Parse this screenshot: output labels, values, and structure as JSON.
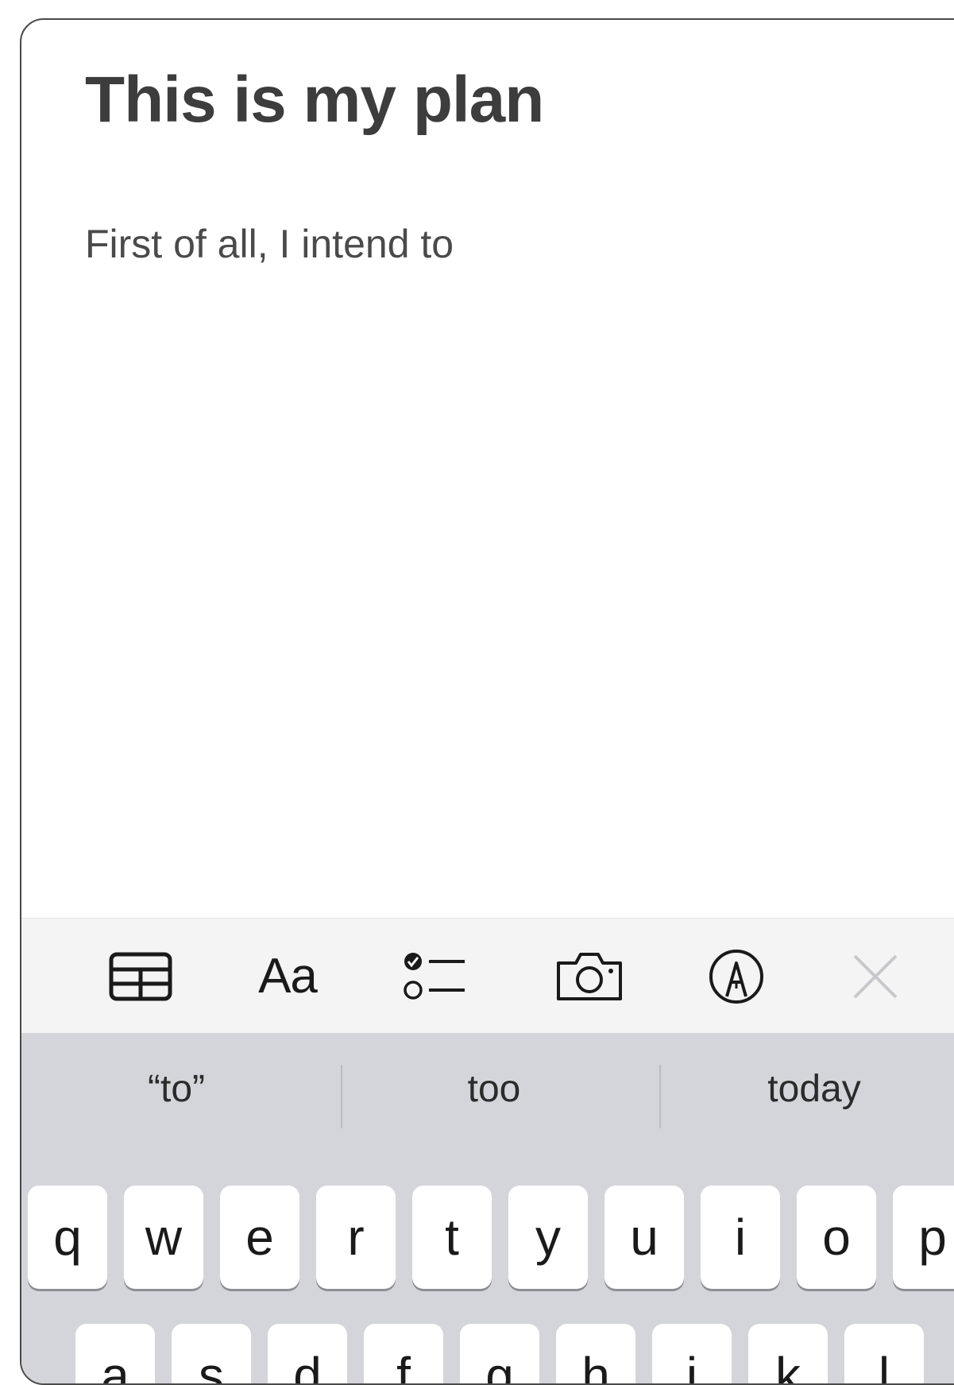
{
  "note": {
    "title": "This is my plan",
    "body": "First of all, I intend to"
  },
  "toolbar": {
    "items": [
      {
        "name": "table-icon"
      },
      {
        "name": "text-format-icon",
        "label": "Aa"
      },
      {
        "name": "checklist-icon"
      },
      {
        "name": "camera-icon"
      },
      {
        "name": "markup-pen-icon"
      },
      {
        "name": "close-icon"
      }
    ]
  },
  "keyboard": {
    "suggestions": [
      "“to”",
      "too",
      "today"
    ],
    "row1": [
      "q",
      "w",
      "e",
      "r",
      "t",
      "y",
      "u",
      "i",
      "o",
      "p"
    ],
    "row2": [
      "a",
      "s",
      "d",
      "f",
      "g",
      "h",
      "j",
      "k",
      "l"
    ]
  },
  "colors": {
    "device_border": "#4a4a4a",
    "toolbar_background": "#f4f4f5",
    "keyboard_background": "#d4d5da",
    "key_background": "#ffffff",
    "close_icon": "#c8c8cc"
  }
}
